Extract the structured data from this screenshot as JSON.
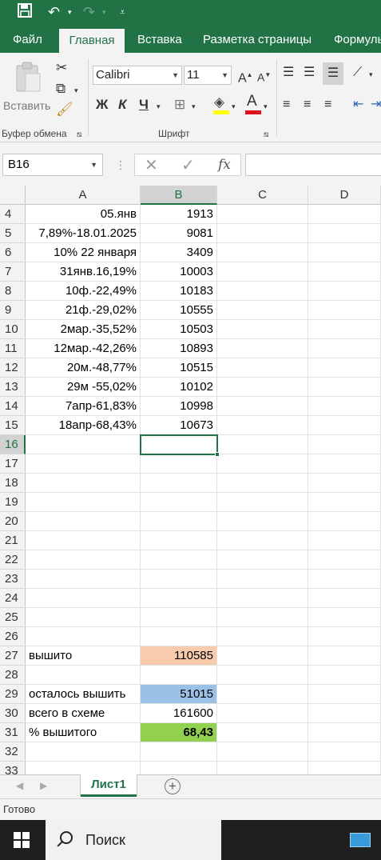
{
  "ribbon": {
    "tabs": [
      {
        "label": "Файл"
      },
      {
        "label": "Главная"
      },
      {
        "label": "Вставка"
      },
      {
        "label": "Разметка страницы"
      },
      {
        "label": "Формулы"
      }
    ],
    "clipboard": {
      "paste_label": "Вставить",
      "group_label": "Буфер обмена"
    },
    "font": {
      "family": "Calibri",
      "size": "11",
      "bold": "Ж",
      "italic": "К",
      "underline": "Ч",
      "group_label": "Шрифт"
    }
  },
  "formula_bar": {
    "name_box": "B16",
    "fx": "fx",
    "value": ""
  },
  "columns": [
    "A",
    "B",
    "C",
    "D"
  ],
  "selected_cell": "B16",
  "rows": [
    {
      "n": "4",
      "a": "05.янв",
      "b": "1913"
    },
    {
      "n": "5",
      "a": "7,89%-18.01.2025",
      "b": "9081"
    },
    {
      "n": "6",
      "a": "10% 22 января",
      "b": "3409"
    },
    {
      "n": "7",
      "a": "31янв.16,19%",
      "b": "10003"
    },
    {
      "n": "8",
      "a": "10ф.-22,49%",
      "b": "10183"
    },
    {
      "n": "9",
      "a": "21ф.-29,02%",
      "b": "10555"
    },
    {
      "n": "10",
      "a": "2мар.-35,52%",
      "b": "10503"
    },
    {
      "n": "11",
      "a": "12мар.-42,26%",
      "b": "10893"
    },
    {
      "n": "12",
      "a": "20м.-48,77%",
      "b": "10515"
    },
    {
      "n": "13",
      "a": "29м -55,02%",
      "b": "10102"
    },
    {
      "n": "14",
      "a": "7апр-61,83%",
      "b": "10998"
    },
    {
      "n": "15",
      "a": "18апр-68,43%",
      "b": "10673"
    },
    {
      "n": "16",
      "a": "",
      "b": ""
    },
    {
      "n": "17",
      "a": "",
      "b": ""
    },
    {
      "n": "18",
      "a": "",
      "b": ""
    },
    {
      "n": "19",
      "a": "",
      "b": ""
    },
    {
      "n": "20",
      "a": "",
      "b": ""
    },
    {
      "n": "21",
      "a": "",
      "b": ""
    },
    {
      "n": "22",
      "a": "",
      "b": ""
    },
    {
      "n": "23",
      "a": "",
      "b": ""
    },
    {
      "n": "24",
      "a": "",
      "b": ""
    },
    {
      "n": "25",
      "a": "",
      "b": ""
    },
    {
      "n": "26",
      "a": "",
      "b": ""
    },
    {
      "n": "27",
      "a": "вышито",
      "b": "110585",
      "fill": "#f8cbad"
    },
    {
      "n": "28",
      "a": "",
      "b": ""
    },
    {
      "n": "29",
      "a": "осталось вышить",
      "b": "51015",
      "fill": "#9bc2e6"
    },
    {
      "n": "30",
      "a": "всего в схеме",
      "b": "161600"
    },
    {
      "n": "31",
      "a": "% вышитого",
      "b": "68,43",
      "fill": "#92d050",
      "bold": true
    },
    {
      "n": "32",
      "a": "",
      "b": ""
    },
    {
      "n": "33",
      "a": "",
      "b": ""
    }
  ],
  "sheet_tabs": [
    {
      "label": "Лист1"
    }
  ],
  "status": {
    "text": "Готово"
  },
  "taskbar": {
    "search_placeholder": "Поиск"
  },
  "colors": {
    "accent": "#217346"
  }
}
